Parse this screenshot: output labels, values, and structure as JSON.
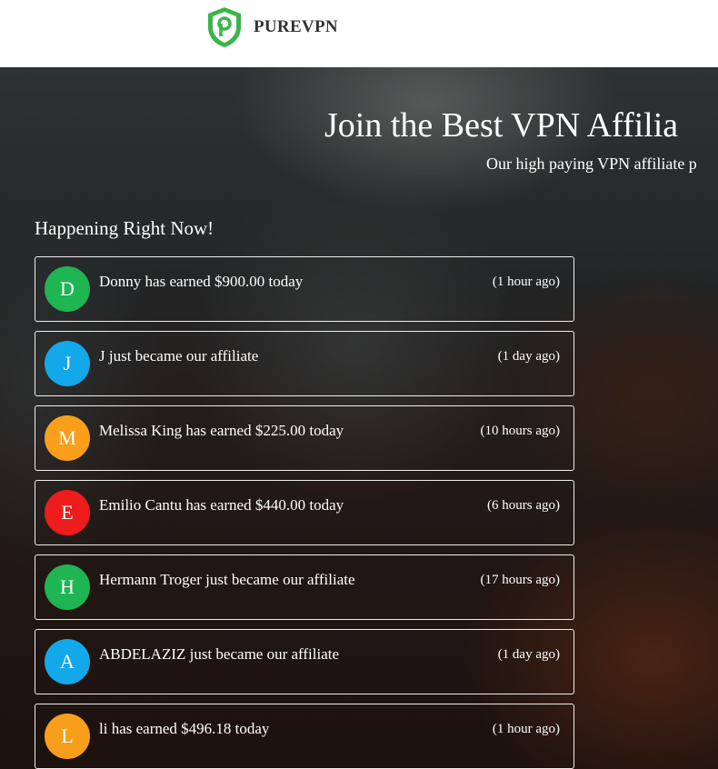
{
  "brand": {
    "name": "PUREVPN",
    "logo_icon": "purevpn-shield-logo",
    "brand_color": "#3cb54a"
  },
  "hero": {
    "title": "Join the Best VPN Affilia",
    "subtitle": "Our high paying VPN affiliate p"
  },
  "feed": {
    "title": "Happening Right Now!",
    "items": [
      {
        "initial": "D",
        "color": "#1eb552",
        "message": "Donny has earned $900.00 today",
        "time": "(1 hour ago)"
      },
      {
        "initial": "J",
        "color": "#12a8e9",
        "message": "J just became our affiliate",
        "time": "(1 day ago)"
      },
      {
        "initial": "M",
        "color": "#f99f1b",
        "message": "Melissa King has earned $225.00 today",
        "time": "(10 hours ago)"
      },
      {
        "initial": "E",
        "color": "#ee1c1c",
        "message": "Emilio Cantu has earned $440.00 today",
        "time": "(6 hours ago)"
      },
      {
        "initial": "H",
        "color": "#1eb552",
        "message": "Hermann Troger just became our affiliate",
        "time": "(17 hours ago)"
      },
      {
        "initial": "A",
        "color": "#12a8e9",
        "message": "ABDELAZIZ just became our affiliate",
        "time": "(1 day ago)"
      },
      {
        "initial": "L",
        "color": "#f99f1b",
        "message": "li has earned $496.18 today",
        "time": "(1 hour ago)"
      }
    ]
  }
}
